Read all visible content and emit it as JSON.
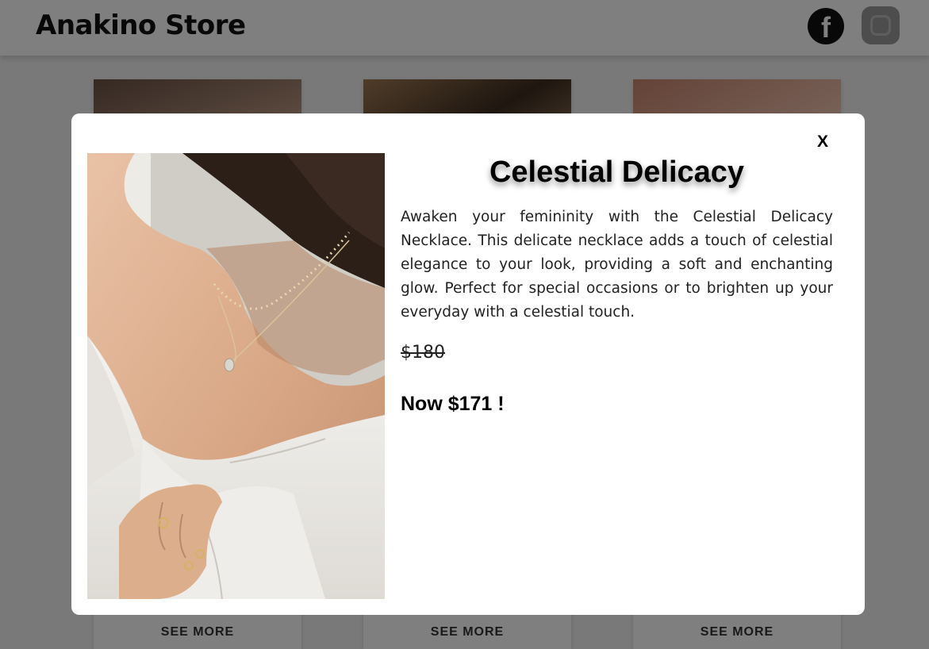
{
  "store": {
    "title": "Anakino Store",
    "social": [
      {
        "icon": "facebook-icon",
        "glyph": "f"
      },
      {
        "icon": "instagram-icon"
      }
    ],
    "cards": [
      {
        "more_label": "SEE MORE"
      },
      {
        "more_label": "SEE MORE"
      },
      {
        "more_label": "SEE MORE"
      }
    ]
  },
  "modal": {
    "close_label": "X",
    "product": {
      "title": "Celestial Delicacy",
      "description": "Awaken your femininity with the Celestial Delicacy Necklace. This delicate necklace adds a touch of celestial elegance to your look, providing a soft and enchanting glow. Perfect for special occasions or to brighten up your everyday with a celestial touch.",
      "original_price": "$180",
      "sale_price": "Now $171 !"
    }
  },
  "colors": {
    "overlay": "rgba(0,0,0,0.5)",
    "modal_background": "#ffffff",
    "text": "#000000"
  }
}
